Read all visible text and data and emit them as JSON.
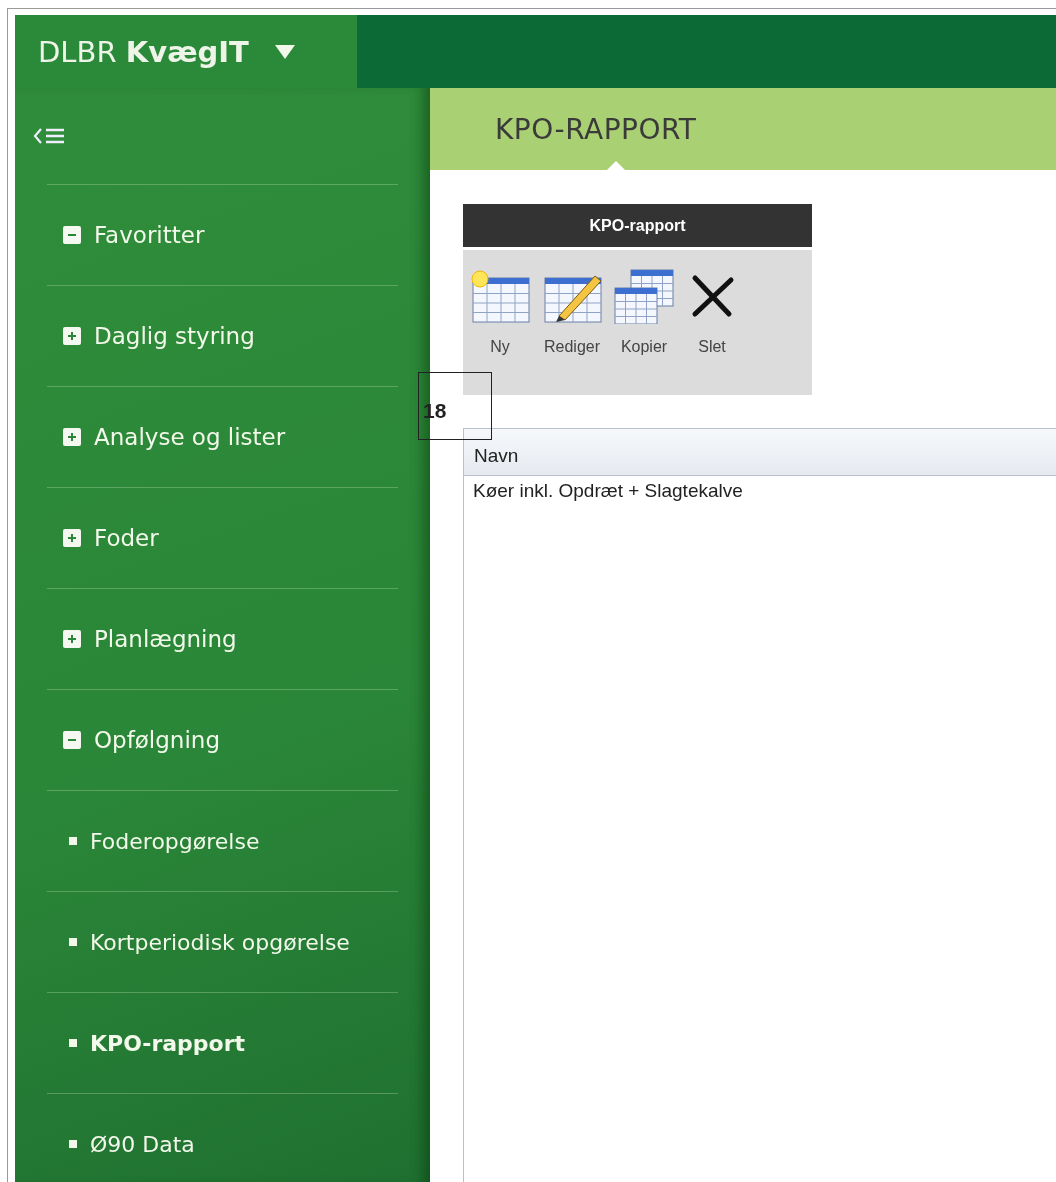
{
  "brand": {
    "title": "DLBR **KvægIT**",
    "menu_open": false
  },
  "sidebar": {
    "items": [
      {
        "kind": "group",
        "label": "Favoritter",
        "expanded": true
      },
      {
        "kind": "group",
        "label": "Daglig styring",
        "expanded": false
      },
      {
        "kind": "group",
        "label": "Analyse og lister",
        "expanded": false
      },
      {
        "kind": "group",
        "label": "Foder",
        "expanded": false
      },
      {
        "kind": "group",
        "label": "Planlægning",
        "expanded": false
      },
      {
        "kind": "group",
        "label": "Opfølgning",
        "expanded": true,
        "children": [
          {
            "kind": "link",
            "label": "Foderopgørelse",
            "selected": false
          },
          {
            "kind": "link",
            "label": "Kortperiodisk opgørelse",
            "selected": false
          },
          {
            "kind": "link",
            "label": "KPO-rapport",
            "selected": true
          },
          {
            "kind": "link",
            "label": "Ø90 Data",
            "selected": false
          }
        ]
      }
    ]
  },
  "page_title": "KPO-RAPPORT",
  "toolbar": {
    "title": "KPO-rapport",
    "buttons": [
      {
        "kind": "new",
        "label": "Ny"
      },
      {
        "kind": "edit",
        "label": "Rediger"
      },
      {
        "kind": "copy",
        "label": "Kopier"
      },
      {
        "kind": "delete",
        "label": "Slet"
      }
    ]
  },
  "callout": "18",
  "table": {
    "columns": [
      "Navn"
    ],
    "rows": [
      [
        "Køer inkl. Opdræt + Slagtekalve"
      ]
    ]
  }
}
